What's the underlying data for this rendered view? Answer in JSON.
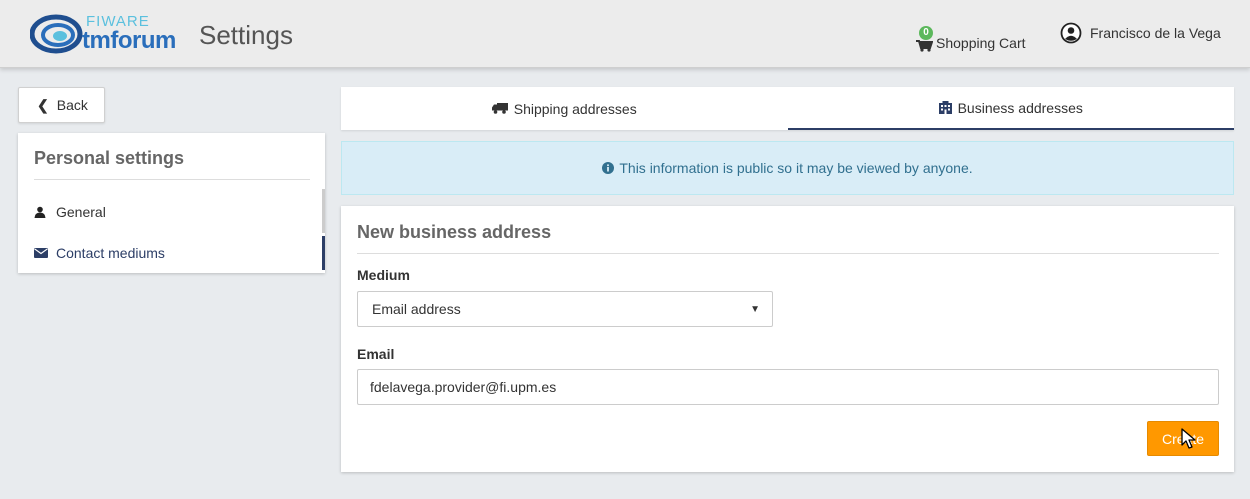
{
  "header": {
    "logo_top": "FIWARE",
    "logo_bottom": "tmforum",
    "title": "Settings",
    "cart_count": "0",
    "cart_label": "Shopping Cart",
    "user_name": "Francisco de la Vega"
  },
  "sidebar": {
    "back_label": "Back",
    "title": "Personal settings",
    "items": [
      {
        "label": "General",
        "icon": "user-icon"
      },
      {
        "label": "Contact mediums",
        "icon": "envelope-icon",
        "active": true
      }
    ]
  },
  "tabs": [
    {
      "label": "Shipping addresses",
      "icon": "truck-icon",
      "active": false
    },
    {
      "label": "Business addresses",
      "icon": "building-icon",
      "active": true
    }
  ],
  "alert": {
    "text": "This information is public so it may be viewed by anyone.",
    "icon": "info-icon"
  },
  "form": {
    "title": "New business address",
    "medium_label": "Medium",
    "medium_value": "Email address",
    "email_label": "Email",
    "email_value": "fdelavega.provider@fi.upm.es",
    "create_label": "Create"
  },
  "colors": {
    "accent": "#ff9800",
    "nav_active": "#2c3e66",
    "badge": "#5cb85c",
    "alert_bg": "#d9edf7"
  }
}
